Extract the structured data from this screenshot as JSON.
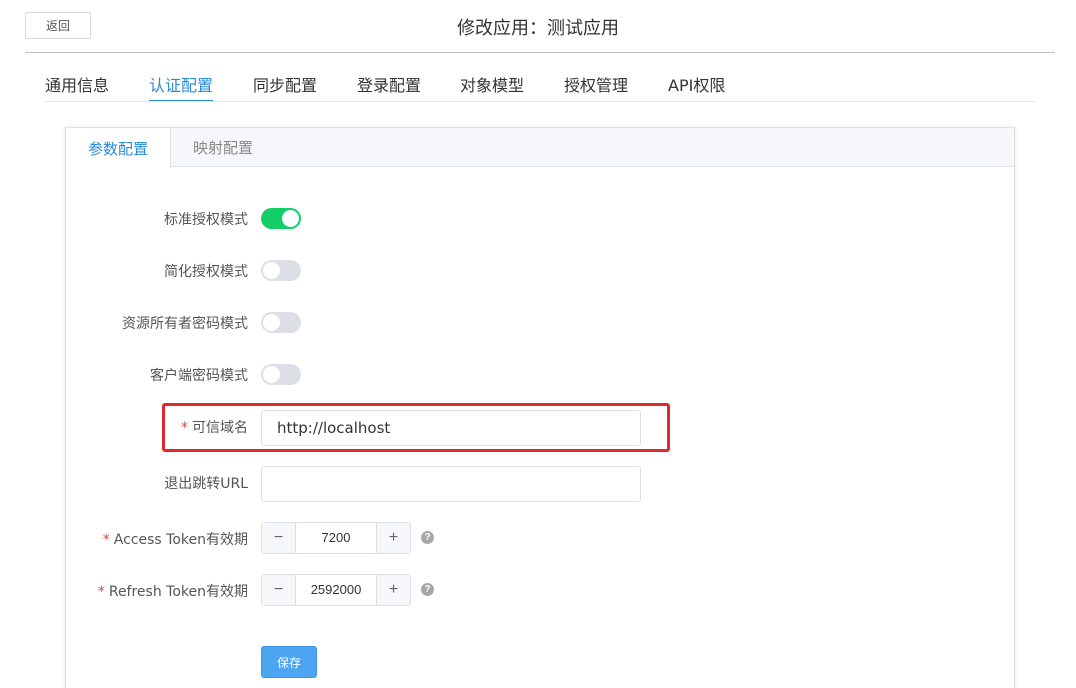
{
  "header": {
    "back_label": "返回",
    "title": "修改应用：测试应用"
  },
  "tabs": [
    {
      "label": "通用信息",
      "active": false
    },
    {
      "label": "认证配置",
      "active": true
    },
    {
      "label": "同步配置",
      "active": false
    },
    {
      "label": "登录配置",
      "active": false
    },
    {
      "label": "对象模型",
      "active": false
    },
    {
      "label": "授权管理",
      "active": false
    },
    {
      "label": "API权限",
      "active": false
    }
  ],
  "subtabs": [
    {
      "label": "参数配置",
      "active": true
    },
    {
      "label": "映射配置",
      "active": false
    }
  ],
  "form": {
    "standard_auth": {
      "label": "标准授权模式",
      "on": true
    },
    "implicit_auth": {
      "label": "简化授权模式",
      "on": false
    },
    "password_auth": {
      "label": "资源所有者密码模式",
      "on": false
    },
    "client_auth": {
      "label": "客户端密码模式",
      "on": false
    },
    "trusted_domain": {
      "required_mark": "*",
      "label": "可信域名",
      "value": "http://localhost"
    },
    "logout_url": {
      "label": "退出跳转URL",
      "value": ""
    },
    "access_token": {
      "required_mark": "*",
      "label": "Access Token有效期",
      "value": "7200",
      "minus": "−",
      "plus": "+",
      "help": "?"
    },
    "refresh_token": {
      "required_mark": "*",
      "label": "Refresh Token有效期",
      "value": "2592000",
      "minus": "−",
      "plus": "+",
      "help": "?"
    },
    "save_label": "保存"
  },
  "colors": {
    "accent": "#2a8ad4",
    "switch_on": "#13ce66",
    "switch_off": "#dcdfe6",
    "required": "#e64242",
    "highlight_border": "#dd2b2b",
    "save_button": "#4ba5f0"
  }
}
